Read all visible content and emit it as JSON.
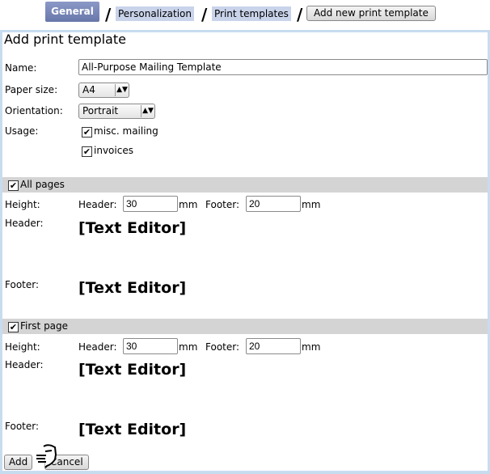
{
  "breadcrumb": {
    "items": [
      "General",
      "Personalization",
      "Print templates"
    ],
    "current": "Add new print template",
    "separator": "/"
  },
  "form": {
    "title": "Add print template",
    "name": {
      "label": "Name:",
      "value": "All-Purpose Mailing Template"
    },
    "paper_size": {
      "label": "Paper size:",
      "value": "A4"
    },
    "orientation": {
      "label": "Orientation:",
      "value": "Portrait"
    },
    "usage": {
      "label": "Usage:",
      "options": [
        {
          "label": "misc. mailing",
          "checked": true
        },
        {
          "label": "invoices",
          "checked": true
        }
      ]
    },
    "sections": [
      {
        "title": "All pages",
        "checked": true,
        "height_label": "Height:",
        "header_label": "Header:",
        "header_value": "30",
        "footer_label": "Footer:",
        "footer_value": "20",
        "unit": "mm",
        "header_row_label": "Header:",
        "footer_row_label": "Footer:",
        "header_editor": "[Text Editor]",
        "footer_editor": "[Text Editor]"
      },
      {
        "title": "First page",
        "checked": true,
        "height_label": "Height:",
        "header_label": "Header:",
        "header_value": "30",
        "footer_label": "Footer:",
        "footer_value": "20",
        "unit": "mm",
        "header_row_label": "Header:",
        "footer_row_label": "Footer:",
        "header_editor": "[Text Editor]",
        "footer_editor": "[Text Editor]"
      }
    ],
    "add_label": "Add",
    "cancel_label": "Cancel"
  }
}
